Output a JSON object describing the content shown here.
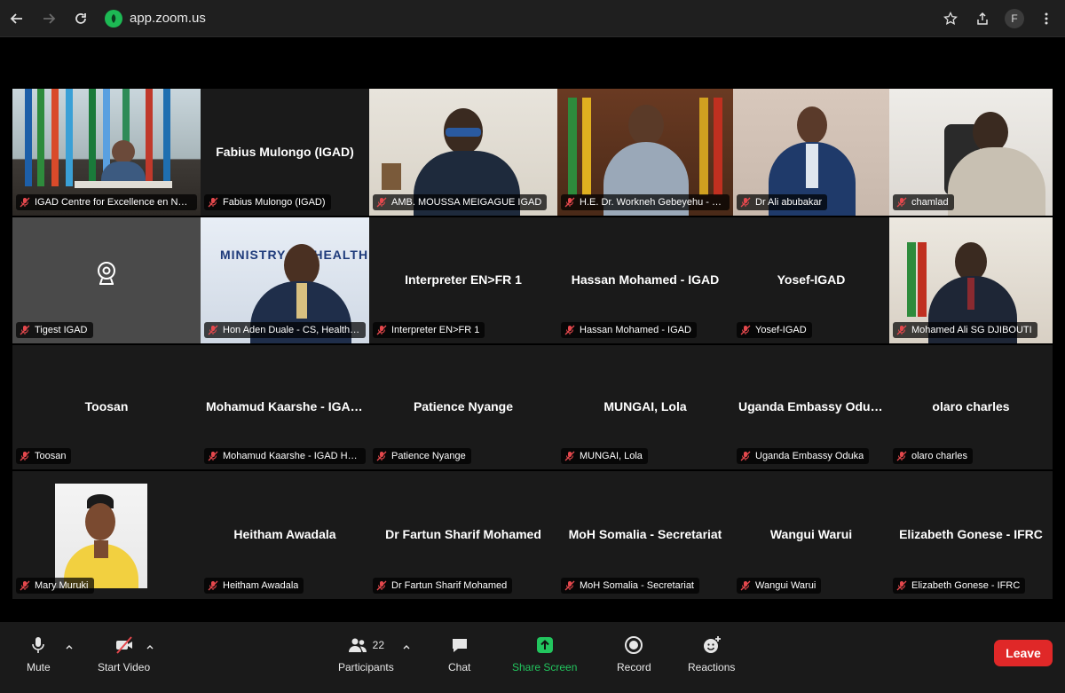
{
  "browser": {
    "url": "app.zoom.us",
    "profile_initial": "F"
  },
  "participants": [
    {
      "name": "IGAD Centre for Excellence en Nutritio...",
      "center": "",
      "video": true
    },
    {
      "name": "Fabius Mulongo (IGAD)",
      "center": "Fabius Mulongo (IGAD)",
      "video": false
    },
    {
      "name": "AMB. MOUSSA MEIGAGUE IGAD",
      "center": "",
      "video": true
    },
    {
      "name": "H.E. Dr. Workneh Gebeyehu - IGAD Exec...",
      "center": "",
      "video": true
    },
    {
      "name": "Dr Ali abubakar",
      "center": "",
      "video": true
    },
    {
      "name": "chamlad",
      "center": "",
      "video": true
    },
    {
      "name": "Tigest IGAD",
      "center": "",
      "video": false
    },
    {
      "name": "Hon Aden Duale - CS, Health Kenya",
      "center": "",
      "video": true
    },
    {
      "name": "Interpreter EN>FR 1",
      "center": "Interpreter EN>FR 1",
      "video": false
    },
    {
      "name": "Hassan Mohamed - IGAD",
      "center": "Hassan Mohamed - IGAD",
      "video": false
    },
    {
      "name": "Yosef-IGAD",
      "center": "Yosef-IGAD",
      "video": false
    },
    {
      "name": "Mohamed Ali SG DJIBOUTI",
      "center": "",
      "video": true
    },
    {
      "name": "Toosan",
      "center": "Toosan",
      "video": false
    },
    {
      "name": "Mohamud Kaarshe - IGAD HoM Somalia",
      "center": "Mohamud Kaarshe - IGAD H...",
      "video": false
    },
    {
      "name": "Patience Nyange",
      "center": "Patience Nyange",
      "video": false
    },
    {
      "name": "MUNGAI, Lola",
      "center": "MUNGAI, Lola",
      "video": false
    },
    {
      "name": "Uganda Embassy Oduka",
      "center": "Uganda Embassy Oduka",
      "video": false
    },
    {
      "name": "olaro charles",
      "center": "olaro charles",
      "video": false
    },
    {
      "name": "Mary Muruki",
      "center": "",
      "video": true
    },
    {
      "name": "Heitham Awadala",
      "center": "Heitham Awadala",
      "video": false
    },
    {
      "name": "Dr Fartun Sharif Mohamed",
      "center": "Dr Fartun Sharif Mohamed",
      "video": false
    },
    {
      "name": "MoH Somalia - Secretariat",
      "center": "MoH Somalia - Secretariat",
      "video": false
    },
    {
      "name": "Wangui Warui",
      "center": "Wangui Warui",
      "video": false
    },
    {
      "name": "Elizabeth Gonese - IFRC",
      "center": "Elizabeth Gonese - IFRC",
      "video": false
    }
  ],
  "video_text": {
    "ministry_sign": "MINISTRY OF HEALTH"
  },
  "toolbar": {
    "mute": "Mute",
    "start_video": "Start Video",
    "participants": "Participants",
    "participants_count": "22",
    "chat": "Chat",
    "share_screen": "Share Screen",
    "record": "Record",
    "reactions": "Reactions",
    "leave": "Leave"
  },
  "colors": {
    "share_green": "#22c55e",
    "leave_red": "#e02828",
    "muted_red": "#e5484d"
  }
}
